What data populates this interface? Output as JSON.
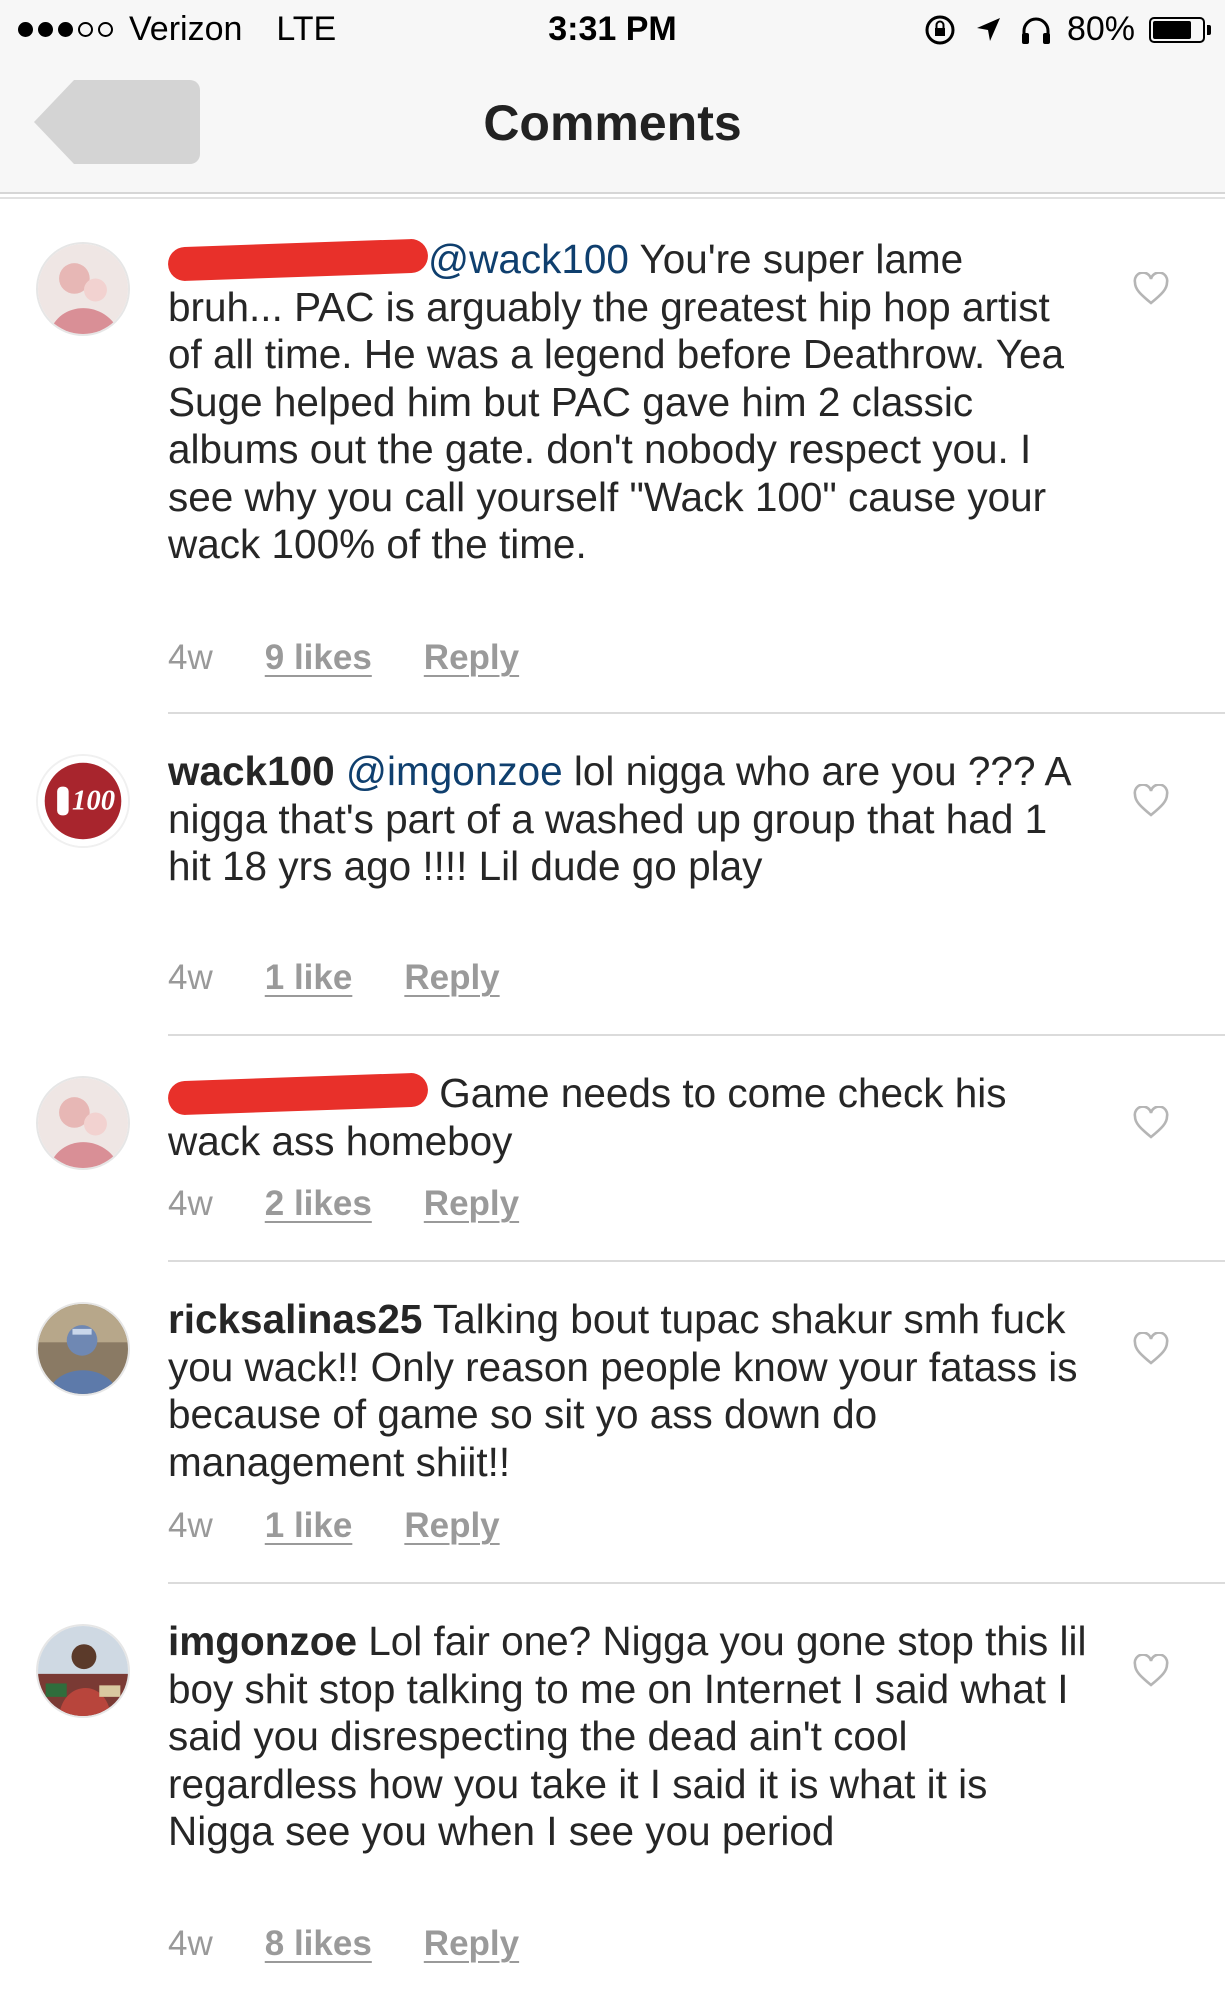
{
  "status_bar": {
    "carrier": "Verizon",
    "network": "LTE",
    "time": "3:31 PM",
    "battery": "80%",
    "battery_level": 0.8,
    "signal_bars": 3
  },
  "nav": {
    "title": "Comments",
    "back_icon": "chevron-back-icon"
  },
  "comments": [
    {
      "username": "",
      "mention": "@wack100",
      "text": " You're super lame bruh... PAC is arguably the greatest hip hop artist of all time. He was a legend before Deathrow. Yea Suge helped him but PAC gave him 2 classic albums out the gate. don't nobody respect you. I see why you call yourself \"Wack 100\" cause your wack 100% of the time.",
      "time": "4w",
      "likes": "9 likes",
      "reply": "Reply"
    },
    {
      "username": "wack100",
      "mention": "@imgonzoe",
      "text": " lol nigga who are you ??? A nigga that's part of a washed up group that had 1 hit 18 yrs ago !!!! Lil dude go play",
      "time": "4w",
      "likes": "1 like",
      "reply": "Reply"
    },
    {
      "username": "",
      "mention": "",
      "text": " Game needs to come check his wack ass homeboy",
      "time": "4w",
      "likes": "2 likes",
      "reply": "Reply"
    },
    {
      "username": "ricksalinas25",
      "mention": "",
      "text": " Talking bout tupac shakur smh fuck you wack!! Only reason people know your fatass is because of game so sit yo ass down do management shiit!!",
      "time": "4w",
      "likes": "1 like",
      "reply": "Reply"
    },
    {
      "username": "imgonzoe",
      "mention": "",
      "text": " Lol fair one? Nigga you gone stop this lil boy shit stop talking to me on Internet I said what I said you disrespecting the dead ain't cool regardless how you take it I said it is what it is Nigga see you when I see you period",
      "time": "4w",
      "likes": "8 likes",
      "reply": "Reply"
    }
  ],
  "colors": {
    "mention": "#0f3f6e",
    "meta": "#999999",
    "redaction": "#e8302a",
    "bar_background": "#f7f7f7"
  }
}
